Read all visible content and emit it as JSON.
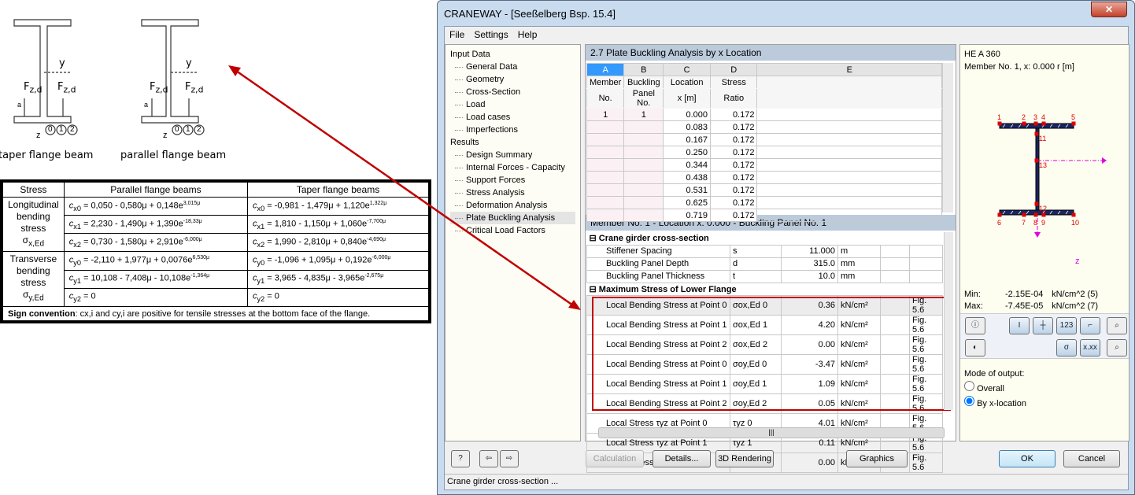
{
  "scan": {
    "left_caption": "taper flange beam",
    "right_caption": "parallel flange beam",
    "labels": {
      "y": "y",
      "z": "z",
      "force": "F",
      "force_sub": "z,d",
      "a": "a",
      "points": [
        "0",
        "1",
        "2"
      ]
    },
    "table": {
      "headers": [
        "Stress",
        "Parallel flange beams",
        "Taper flange beams"
      ],
      "groups": [
        {
          "stress": "Longitudinal bending stress",
          "symbol": "σ",
          "symbol_sub": "x,Ed",
          "rows": [
            [
              "c",
              "x0",
              " = 0,050 - 0,580μ + 0,148e",
              "3,015μ",
              "c",
              "x0",
              " = -0,981 - 1,479μ + 1,120e",
              "1,322μ"
            ],
            [
              "c",
              "x1",
              " = 2,230 - 1,490μ + 1,390e",
              "-18,33μ",
              "c",
              "x1",
              " = 1,810 - 1,150μ + 1,060e",
              "-7,700μ"
            ],
            [
              "c",
              "x2",
              " = 0,730 - 1,580μ + 2,910e",
              "-6,000μ",
              "c",
              "x2",
              " = 1,990 - 2,810μ + 0,840e",
              "-4,690μ"
            ]
          ]
        },
        {
          "stress": "Transverse bending stress",
          "symbol": "σ",
          "symbol_sub": "y,Ed",
          "rows": [
            [
              "c",
              "y0",
              " = -2,110 + 1,977μ + 0,0076e",
              "6,530μ",
              "c",
              "y0",
              " = -1,096 + 1,095μ + 0,192e",
              "-6,000μ"
            ],
            [
              "c",
              "y1",
              " = 10,108 - 7,408μ - 10,108e",
              "-1,364μ",
              "c",
              "y1",
              " = 3,965 - 4,835μ - 3,965e",
              "-2,675μ"
            ],
            [
              "c",
              "y2",
              " = 0",
              "",
              "c",
              "y2",
              " = 0",
              ""
            ]
          ]
        }
      ],
      "sign_label": "Sign convention",
      "sign_text": ": cx,i and cy,i are positive for tensile stresses at the bottom face of the flange."
    }
  },
  "arrow_color": "#c00000",
  "window": {
    "title": "CRANEWAY - [Seeßelberg Bsp. 15.4]",
    "close": "✕",
    "menu": [
      "File",
      "Settings",
      "Help"
    ],
    "tree": {
      "input": "Input Data",
      "input_items": [
        "General Data",
        "Geometry",
        "Cross-Section",
        "Load",
        "Load cases",
        "Imperfections"
      ],
      "results": "Results",
      "result_items": [
        "Design Summary",
        "Internal Forces - Capacity",
        "Support Forces",
        "Stress Analysis",
        "Deformation Analysis",
        "Plate Buckling Analysis",
        "Critical Load Factors"
      ]
    },
    "panel_title": "2.7 Plate Buckling Analysis by x Location",
    "grid": {
      "letters": [
        "A",
        "B",
        "C",
        "D",
        "E"
      ],
      "headers1": [
        "Member",
        "Buckling",
        "Location",
        "Stress",
        ""
      ],
      "headers2": [
        "No.",
        "Panel No.",
        "x [m]",
        "Ratio",
        ""
      ],
      "rows": [
        [
          "1",
          "1",
          "0.000",
          "0.172"
        ],
        [
          "",
          "",
          "0.083",
          "0.172"
        ],
        [
          "",
          "",
          "0.167",
          "0.172"
        ],
        [
          "",
          "",
          "0.250",
          "0.172"
        ],
        [
          "",
          "",
          "0.344",
          "0.172"
        ],
        [
          "",
          "",
          "0.438",
          "0.172"
        ],
        [
          "",
          "",
          "0.531",
          "0.172"
        ],
        [
          "",
          "",
          "0.625",
          "0.172"
        ],
        [
          "",
          "",
          "0.719",
          "0.172"
        ]
      ]
    },
    "detail_title": "Member No. 1  -  Location x:  0.000  -  Buckling Panel No. 1",
    "detail": {
      "group1": "Crane girder cross-section",
      "rows1": [
        [
          "Stiffener Spacing",
          "s",
          "",
          "11.000",
          "m",
          "",
          ""
        ],
        [
          "Buckling Panel Depth",
          "d",
          "",
          "315.0",
          "mm",
          "",
          ""
        ],
        [
          "Buckling Panel Thickness",
          "t",
          "",
          "10.0",
          "mm",
          "",
          ""
        ]
      ],
      "group2": "Maximum Stress of Lower Flange",
      "rows2": [
        [
          "Local Bending Stress at Point 0",
          "σox,Ed 0",
          "",
          "0.36",
          "kN/cm²",
          "",
          "Fig. 5.6"
        ],
        [
          "Local Bending Stress at Point 1",
          "σox,Ed 1",
          "",
          "4.20",
          "kN/cm²",
          "",
          "Fig. 5.6"
        ],
        [
          "Local Bending Stress at Point 2",
          "σox,Ed 2",
          "",
          "0.00",
          "kN/cm²",
          "",
          "Fig. 5.6"
        ],
        [
          "Local Bending Stress at Point 0",
          "σoy,Ed 0",
          "",
          "-3.47",
          "kN/cm²",
          "",
          "Fig. 5.6"
        ],
        [
          "Local Bending Stress at Point 1",
          "σoy,Ed 1",
          "",
          "1.09",
          "kN/cm²",
          "",
          "Fig. 5.6"
        ],
        [
          "Local Bending Stress at Point 2",
          "σoy,Ed 2",
          "",
          "0.05",
          "kN/cm²",
          "",
          "Fig. 5.6"
        ],
        [
          "Local Stress τyz at Point 0",
          "τyz 0",
          "",
          "4.01",
          "kN/cm²",
          "",
          "Fig. 5.6"
        ],
        [
          "Local Stress τyz at Point 1",
          "τyz 1",
          "",
          "0.11",
          "kN/cm²",
          "",
          "Fig. 5.6"
        ],
        [
          "Local Stress τyz at Point 2",
          "τyz 2",
          "",
          "0.00",
          "kN/cm²",
          "",
          "Fig. 5.6"
        ]
      ]
    },
    "section": {
      "name": "HE A 360",
      "member": "Member No. 1, x: 0.000 r [m]",
      "points": [
        "1",
        "2",
        "3",
        "4",
        "5",
        "6",
        "7",
        "8",
        "9",
        "10",
        "11",
        "12",
        "13"
      ],
      "y": "y",
      "z": "z",
      "min_label": "Min:",
      "min_value": "-2.15E-04",
      "min_unit": "kN/cm^2 (5)",
      "max_label": "Max:",
      "max_value": "-7.45E-05",
      "max_unit": "kN/cm^2 (7)"
    },
    "output_mode": {
      "label": "Mode of output:",
      "options": [
        "Overall",
        "By x-location"
      ],
      "selected": "By x-location"
    },
    "buttons": {
      "calculation": "Calculation",
      "details": "Details...",
      "rendering": "3D Rendering",
      "graphics": "Graphics",
      "ok": "OK",
      "cancel": "Cancel"
    },
    "status": "Crane girder cross-section ..."
  }
}
